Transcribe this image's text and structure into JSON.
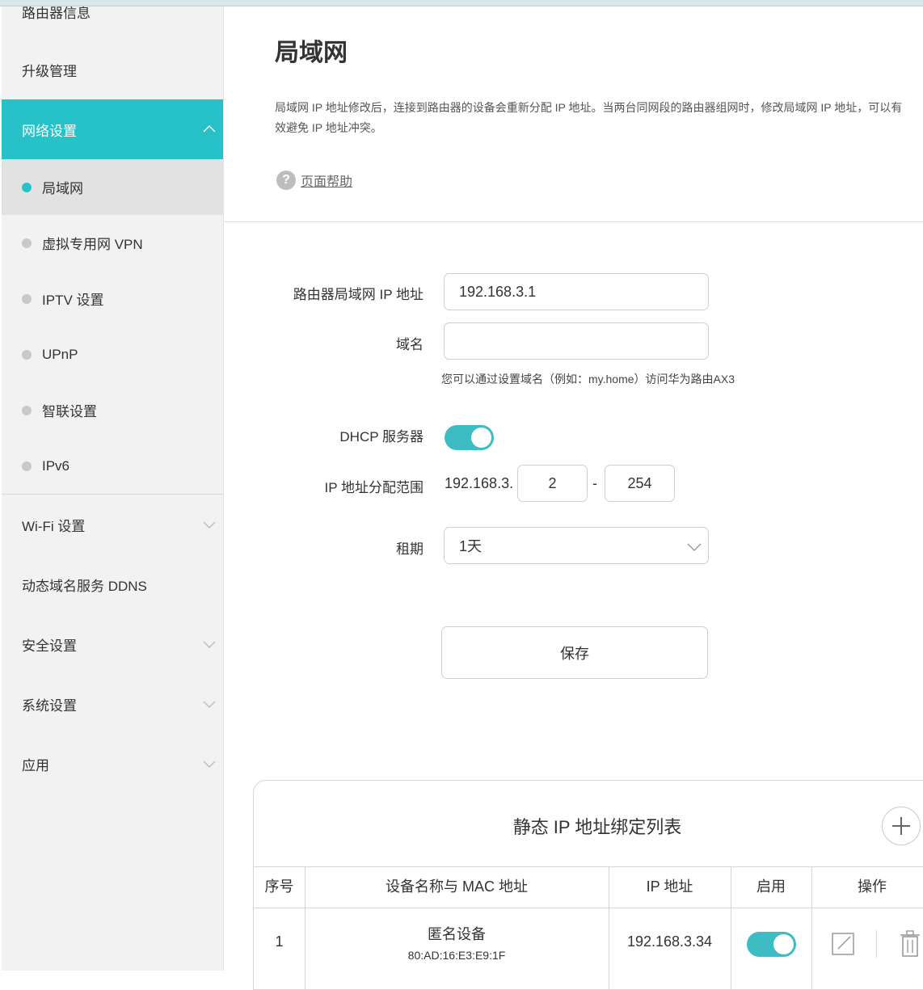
{
  "sidebar": {
    "items": [
      {
        "label": "路由器信息"
      },
      {
        "label": "升级管理"
      },
      {
        "label": "网络设置",
        "submenu": [
          {
            "label": "局域网"
          },
          {
            "label": "虚拟专用网 VPN"
          },
          {
            "label": "IPTV 设置"
          },
          {
            "label": "UPnP"
          },
          {
            "label": "智联设置"
          },
          {
            "label": "IPv6"
          }
        ]
      },
      {
        "label": "Wi-Fi 设置"
      },
      {
        "label": "动态域名服务 DDNS"
      },
      {
        "label": "安全设置"
      },
      {
        "label": "系统设置"
      },
      {
        "label": "应用"
      }
    ]
  },
  "page": {
    "title": "局域网",
    "description": "局域网 IP 地址修改后，连接到路由器的设备会重新分配 IP 地址。当两台同网段的路由器组网时，修改局域网 IP 地址，可以有效避免 IP 地址冲突。",
    "help_link": "页面帮助"
  },
  "form": {
    "lan_ip_label": "路由器局域网 IP 地址",
    "lan_ip_value": "192.168.3.1",
    "domain_label": "域名",
    "domain_value": "",
    "domain_hint": "您可以通过设置域名（例如：my.home）访问华为路由AX3",
    "dhcp_label": "DHCP 服务器",
    "dhcp_enabled": true,
    "range_label": "IP 地址分配范围",
    "range_prefix": "192.168.3.",
    "range_start": "2",
    "range_sep": "-",
    "range_end": "254",
    "lease_label": "租期",
    "lease_value": "1天",
    "save_label": "保存"
  },
  "static_table": {
    "title": "静态 IP 地址绑定列表",
    "columns": [
      "序号",
      "设备名称与 MAC 地址",
      "IP 地址",
      "启用",
      "操作"
    ],
    "rows": [
      {
        "index": "1",
        "name": "匿名设备",
        "mac": "80:AD:16:E3:E9:1F",
        "ip": "192.168.3.34",
        "enabled": true
      }
    ]
  },
  "colors": {
    "accent": "#27c2c8",
    "toggle_on": "#3dbdc3",
    "sidebar_bg": "#f2f2f2",
    "selected_bg": "#e2e2e2"
  }
}
